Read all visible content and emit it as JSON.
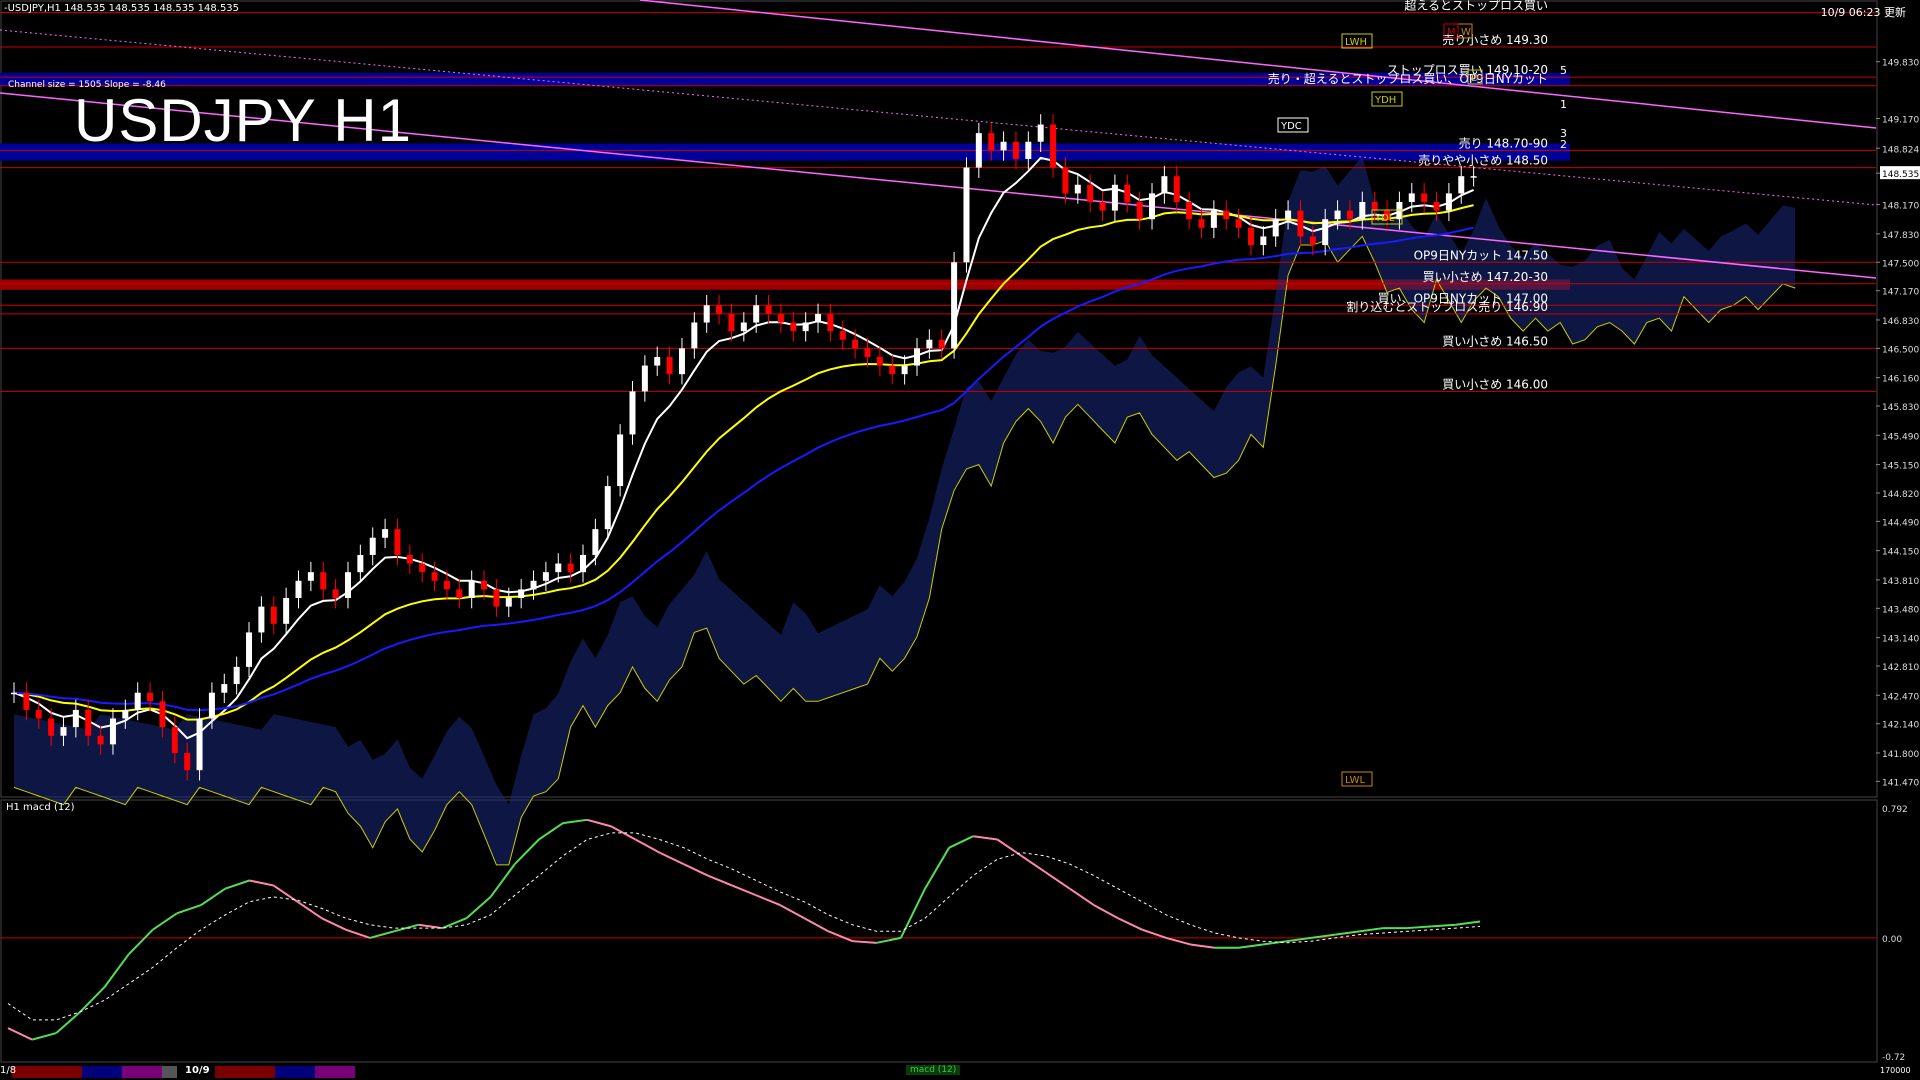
{
  "header": {
    "symbol_info": "-USDJPY,H1  148.535 148.535 148.535 148.535",
    "title": "USDJPY H1",
    "channel_info": "Channel size = 1505 Slope = -8.46",
    "timestamp": "10/9 06:23 更新"
  },
  "chart_data": [
    {
      "type": "candlestick",
      "title": "USDJPY H1",
      "ylim": [
        141.3,
        150.5
      ],
      "yticks": [
        "149.830",
        "149.170",
        "148.824",
        "148.535",
        "148.170",
        "147.830",
        "147.500",
        "147.170",
        "146.830",
        "146.500",
        "146.160",
        "145.830",
        "145.490",
        "145.150",
        "144.820",
        "144.490",
        "144.150",
        "143.810",
        "143.480",
        "143.140",
        "142.810",
        "142.470",
        "142.140",
        "141.800",
        "141.470"
      ],
      "current_price": "148.535",
      "close_series": [
        142.5,
        142.3,
        142.2,
        142.0,
        142.1,
        142.3,
        142.0,
        141.9,
        142.2,
        142.3,
        142.5,
        142.4,
        142.1,
        141.8,
        141.6,
        142.2,
        142.5,
        142.6,
        142.8,
        143.2,
        143.5,
        143.3,
        143.6,
        143.8,
        143.9,
        143.7,
        143.6,
        143.9,
        144.1,
        144.3,
        144.4,
        144.1,
        144.0,
        143.9,
        143.8,
        143.7,
        143.6,
        143.8,
        143.7,
        143.5,
        143.6,
        143.7,
        143.8,
        143.9,
        144.0,
        143.9,
        144.1,
        144.4,
        144.9,
        145.5,
        146.0,
        146.3,
        146.4,
        146.2,
        146.5,
        146.8,
        147.0,
        146.9,
        146.7,
        146.8,
        147.0,
        146.9,
        146.8,
        146.7,
        146.8,
        146.9,
        146.7,
        146.6,
        146.5,
        146.4,
        146.3,
        146.2,
        146.3,
        146.5,
        146.6,
        146.5,
        147.5,
        148.6,
        149.0,
        148.8,
        148.9,
        148.7,
        148.9,
        149.1,
        148.6,
        148.3,
        148.4,
        148.2,
        148.1,
        148.4,
        148.2,
        148.0,
        148.3,
        148.5,
        148.2,
        148.0,
        147.9,
        148.1,
        148.0,
        147.9,
        147.7,
        147.8,
        148.0,
        148.1,
        147.8,
        147.7,
        148.0,
        148.1,
        148.0,
        148.2,
        148.1,
        148.0,
        148.2,
        148.3,
        148.2,
        148.1,
        148.3,
        148.5,
        148.5
      ],
      "price_lines": [
        {
          "label": "超えるとストップロス買い",
          "value": 150.4
        },
        {
          "label": "売り小さめ 149.30",
          "value": 150.0
        },
        {
          "label": "ストップロス買い 149.10-20",
          "value": 149.65
        },
        {
          "label": "売り・超えるとストップロス買い、OP9日NYカット",
          "value": 149.55
        },
        {
          "label": "売り 148.70-90",
          "value": 148.8
        },
        {
          "label": "売りやや小さめ 148.50",
          "value": 148.6
        },
        {
          "label": "OP9日NYカット 147.50",
          "value": 147.5
        },
        {
          "label": "買い小さめ 147.20-30",
          "value": 147.25
        },
        {
          "label": "買い、OP9日NYカット 147.00",
          "value": 147.0
        },
        {
          "label": "割り込むとストップロス売り 146.90",
          "value": 146.9
        },
        {
          "label": "買い小さめ 146.50",
          "value": 146.5
        },
        {
          "label": "買い小さめ 146.00",
          "value": 146.0
        }
      ],
      "markers": [
        "YDH",
        "YDC",
        "YDL",
        "LWH",
        "LWL",
        "D",
        "W",
        "M"
      ],
      "channel_levels": [
        "1",
        "3",
        "2",
        "5"
      ]
    },
    {
      "type": "line",
      "title": "H1 macd (12)",
      "ylim": [
        -0.72,
        0.792
      ],
      "yticks": [
        "0.792",
        "0.00",
        "-0.72"
      ],
      "macd": [
        -0.55,
        -0.62,
        -0.58,
        -0.45,
        -0.3,
        -0.1,
        0.05,
        0.15,
        0.2,
        0.3,
        0.35,
        0.32,
        0.22,
        0.12,
        0.05,
        0.0,
        0.04,
        0.08,
        0.06,
        0.12,
        0.25,
        0.45,
        0.6,
        0.7,
        0.72,
        0.68,
        0.6,
        0.52,
        0.45,
        0.38,
        0.32,
        0.26,
        0.2,
        0.12,
        0.04,
        -0.02,
        -0.03,
        0.0,
        0.3,
        0.55,
        0.62,
        0.6,
        0.5,
        0.4,
        0.3,
        0.2,
        0.12,
        0.05,
        0.0,
        -0.04,
        -0.06,
        -0.06,
        -0.04,
        -0.02,
        0.0,
        0.02,
        0.04,
        0.06,
        0.06,
        0.07,
        0.08,
        0.1
      ],
      "signal": [
        -0.4,
        -0.5,
        -0.5,
        -0.45,
        -0.38,
        -0.28,
        -0.18,
        -0.06,
        0.05,
        0.14,
        0.22,
        0.25,
        0.23,
        0.18,
        0.12,
        0.08,
        0.06,
        0.06,
        0.06,
        0.08,
        0.14,
        0.26,
        0.38,
        0.5,
        0.6,
        0.64,
        0.64,
        0.6,
        0.55,
        0.48,
        0.42,
        0.35,
        0.28,
        0.22,
        0.14,
        0.08,
        0.04,
        0.04,
        0.12,
        0.25,
        0.38,
        0.48,
        0.52,
        0.5,
        0.45,
        0.38,
        0.3,
        0.22,
        0.14,
        0.08,
        0.03,
        0.0,
        -0.02,
        -0.03,
        -0.02,
        0.0,
        0.02,
        0.03,
        0.04,
        0.05,
        0.06,
        0.07
      ]
    }
  ],
  "subwindow": {
    "title": "H1 macd (12)"
  },
  "statusbar": {
    "left": "1/8",
    "date": "10/9",
    "tab": "macd (12)",
    "right": "170000"
  },
  "colors": {
    "up": "#ffffff",
    "down": "#ff0000",
    "ema_fast": "#ffffff",
    "ema_mid": "#ffff00",
    "ema_slow": "#1a1aff",
    "macd_up": "#55dd55",
    "macd_down": "#ff88aa",
    "signal": "#ffffff",
    "level_line": "#cc0000",
    "band_blue": "#000099",
    "band_red": "#990000",
    "channel": "#ff66ff",
    "text": "#ffffff"
  }
}
